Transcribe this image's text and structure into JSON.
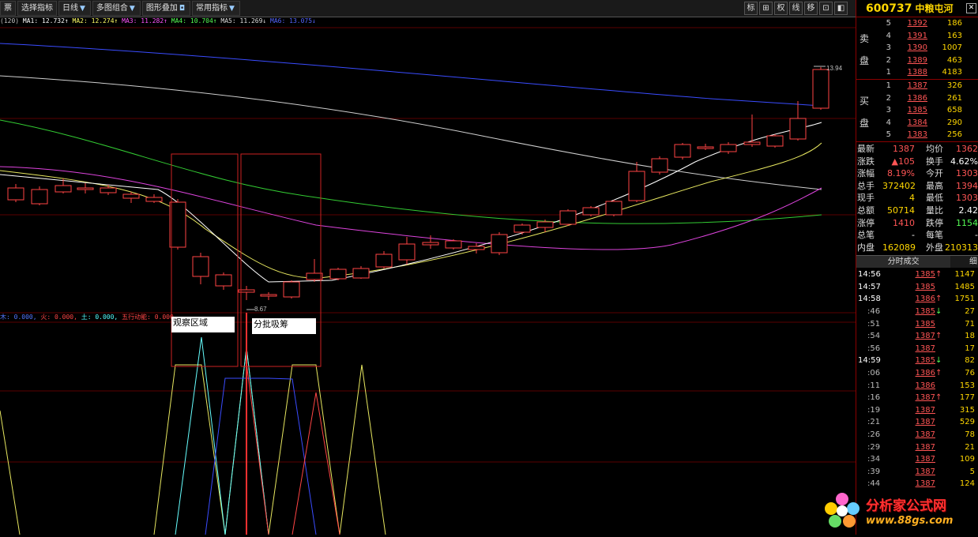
{
  "toolbar": {
    "items": [
      "票",
      "选择指标",
      "日线",
      "多图组合",
      "图形叠加",
      "常用指标"
    ],
    "right_buttons": [
      "标",
      "⊞",
      "权",
      "线",
      "移",
      "⊡",
      "◧"
    ]
  },
  "ma_legend": [
    {
      "text": "(120)",
      "color": "#c0c0c0"
    },
    {
      "text": "MA1: 12.732↑",
      "color": "#ffffff"
    },
    {
      "text": "MA2: 12.274↑",
      "color": "#ffff66"
    },
    {
      "text": "MA3: 11.282↑",
      "color": "#ff55ff"
    },
    {
      "text": "MA4: 10.704↑",
      "color": "#55ff55"
    },
    {
      "text": "MA5: 11.269↓",
      "color": "#dddddd"
    },
    {
      "text": "MA6: 13.075↓",
      "color": "#5566ff"
    }
  ],
  "indicator_legend": [
    {
      "text": "木: 0.000,",
      "color": "#5577ff"
    },
    {
      "text": "火: 0.000,",
      "color": "#ff4444"
    },
    {
      "text": "土: 0.000,",
      "color": "#55ffff"
    },
    {
      "text": "五行动能: 0.000",
      "color": "#ff4444"
    }
  ],
  "annotations": {
    "observe_label": "观察区域",
    "accumulate_label": "分批吸筹",
    "high_label": "13.94",
    "low_label": "8.67"
  },
  "stock": {
    "code": "600737",
    "name": "中粮屯河"
  },
  "orderbook": {
    "sell_label": [
      "卖",
      "盘"
    ],
    "buy_label": [
      "买",
      "盘"
    ],
    "sell": [
      {
        "level": "5",
        "price": "1392",
        "vol": "186"
      },
      {
        "level": "4",
        "price": "1391",
        "vol": "163"
      },
      {
        "level": "3",
        "price": "1390",
        "vol": "1007"
      },
      {
        "level": "2",
        "price": "1389",
        "vol": "463"
      },
      {
        "level": "1",
        "price": "1388",
        "vol": "4183"
      }
    ],
    "buy": [
      {
        "level": "1",
        "price": "1387",
        "vol": "326"
      },
      {
        "level": "2",
        "price": "1386",
        "vol": "261"
      },
      {
        "level": "3",
        "price": "1385",
        "vol": "658"
      },
      {
        "level": "4",
        "price": "1384",
        "vol": "290"
      },
      {
        "level": "5",
        "price": "1383",
        "vol": "256"
      }
    ]
  },
  "stats": [
    {
      "l1": "最新",
      "v1": "1387",
      "c1": "red",
      "l2": "均价",
      "v2": "1362",
      "c2": "red"
    },
    {
      "l1": "涨跌",
      "v1": "▲105",
      "c1": "red",
      "l2": "换手",
      "v2": "4.62%",
      "c2": "wht"
    },
    {
      "l1": "涨幅",
      "v1": "8.19%",
      "c1": "red",
      "l2": "今开",
      "v2": "1303",
      "c2": "red"
    },
    {
      "l1": "总手",
      "v1": "372402",
      "c1": "yel",
      "l2": "最高",
      "v2": "1394",
      "c2": "red"
    },
    {
      "l1": "现手",
      "v1": "4",
      "c1": "yel",
      "l2": "最低",
      "v2": "1303",
      "c2": "red"
    },
    {
      "l1": "总额",
      "v1": "50714",
      "c1": "yel",
      "l2": "量比",
      "v2": "2.42",
      "c2": "wht"
    },
    {
      "l1": "涨停",
      "v1": "1410",
      "c1": "red",
      "l2": "跌停",
      "v2": "1154",
      "c2": "grn"
    },
    {
      "l1": "总笔",
      "v1": "-",
      "c1": "wht",
      "l2": "每笔",
      "v2": "-",
      "c2": "wht"
    },
    {
      "l1": "内盘",
      "v1": "162089",
      "c1": "yel",
      "l2": "外盘",
      "v2": "210313",
      "c2": "yel"
    }
  ],
  "trade_tabs": {
    "main": "分时成交",
    "side": "细"
  },
  "trades": [
    {
      "t": "14:56",
      "sub": false,
      "p": "1385",
      "a": "↑",
      "ac": "red",
      "v": "1147"
    },
    {
      "t": "14:57",
      "sub": false,
      "p": "1385",
      "a": "",
      "ac": "",
      "v": "1485"
    },
    {
      "t": "14:58",
      "sub": false,
      "p": "1386",
      "a": "↑",
      "ac": "red",
      "v": "1751"
    },
    {
      "t": ":46",
      "sub": true,
      "p": "1385",
      "a": "↓",
      "ac": "grn",
      "v": "27"
    },
    {
      "t": ":51",
      "sub": true,
      "p": "1385",
      "a": "",
      "ac": "",
      "v": "71"
    },
    {
      "t": ":54",
      "sub": true,
      "p": "1387",
      "a": "↑",
      "ac": "red",
      "v": "18"
    },
    {
      "t": ":56",
      "sub": true,
      "p": "1387",
      "a": "",
      "ac": "",
      "v": "17"
    },
    {
      "t": "14:59",
      "sub": false,
      "p": "1385",
      "a": "↓",
      "ac": "grn",
      "v": "82"
    },
    {
      "t": ":06",
      "sub": true,
      "p": "1386",
      "a": "↑",
      "ac": "red",
      "v": "76"
    },
    {
      "t": ":11",
      "sub": true,
      "p": "1386",
      "a": "",
      "ac": "",
      "v": "153"
    },
    {
      "t": ":16",
      "sub": true,
      "p": "1387",
      "a": "↑",
      "ac": "red",
      "v": "177"
    },
    {
      "t": ":19",
      "sub": true,
      "p": "1387",
      "a": "",
      "ac": "",
      "v": "315"
    },
    {
      "t": ":21",
      "sub": true,
      "p": "1387",
      "a": "",
      "ac": "",
      "v": "529"
    },
    {
      "t": ":26",
      "sub": true,
      "p": "1387",
      "a": "",
      "ac": "",
      "v": "78"
    },
    {
      "t": ":29",
      "sub": true,
      "p": "1387",
      "a": "",
      "ac": "",
      "v": "21"
    },
    {
      "t": ":34",
      "sub": true,
      "p": "1387",
      "a": "",
      "ac": "",
      "v": "109"
    },
    {
      "t": ":39",
      "sub": true,
      "p": "1387",
      "a": "",
      "ac": "",
      "v": "5"
    },
    {
      "t": ":44",
      "sub": true,
      "p": "1387",
      "a": "",
      "ac": "",
      "v": "124"
    }
  ],
  "watermark": {
    "line1": "分析家公式网",
    "line2": "www.88gs.com"
  }
}
